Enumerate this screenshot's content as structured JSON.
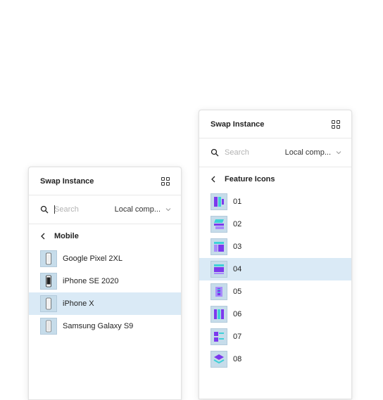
{
  "left_panel": {
    "title": "Swap Instance",
    "search_placeholder": "Search",
    "library": "Local comp...",
    "breadcrumb": "Mobile",
    "items": [
      {
        "label": "Google Pixel 2XL",
        "icon": "phone-icon"
      },
      {
        "label": "iPhone SE 2020",
        "icon": "phone-icon"
      },
      {
        "label": "iPhone X",
        "icon": "phone-icon",
        "selected": true
      },
      {
        "label": "Samsung Galaxy S9",
        "icon": "phone-icon"
      }
    ]
  },
  "right_panel": {
    "title": "Swap Instance",
    "search_placeholder": "Search",
    "library": "Local comp...",
    "breadcrumb": "Feature Icons",
    "items": [
      {
        "label": "01",
        "icon": "feature-icon-01"
      },
      {
        "label": "02",
        "icon": "feature-icon-02"
      },
      {
        "label": "03",
        "icon": "feature-icon-03"
      },
      {
        "label": "04",
        "icon": "feature-icon-04",
        "selected": true
      },
      {
        "label": "05",
        "icon": "feature-icon-05"
      },
      {
        "label": "06",
        "icon": "feature-icon-06"
      },
      {
        "label": "07",
        "icon": "feature-icon-07"
      },
      {
        "label": "08",
        "icon": "feature-icon-08"
      }
    ]
  },
  "colors": {
    "selected_row": "#daeaf6",
    "thumb_bg": "#c6dcea",
    "purple": "#7c3aed",
    "cyan": "#3fd0d8"
  }
}
